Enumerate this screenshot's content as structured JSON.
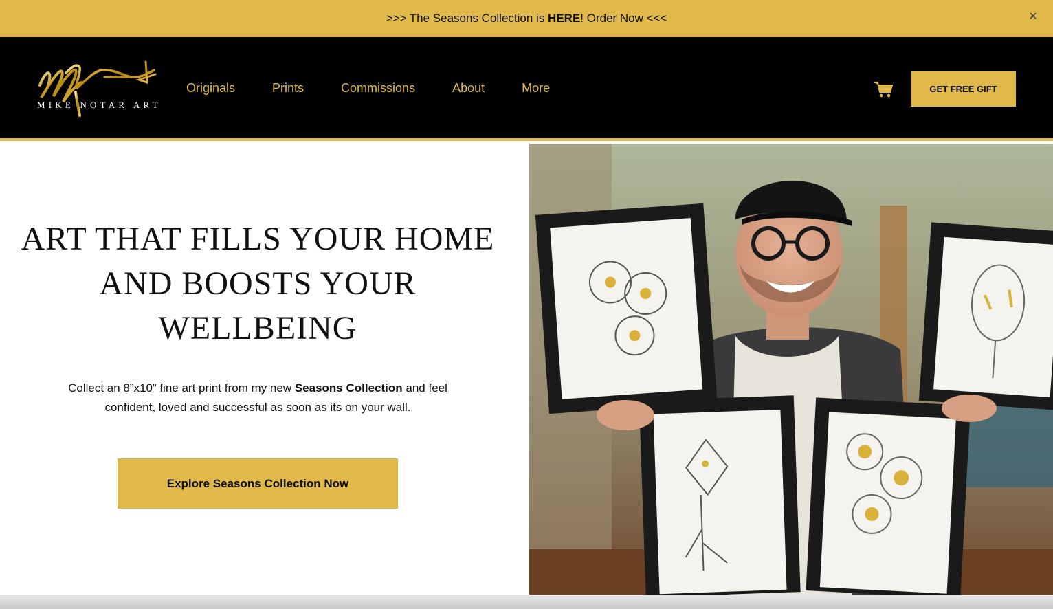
{
  "announcement": {
    "prefix": ">>> The Seasons Collection is ",
    "bold": "HERE",
    "suffix": "! Order Now <<<",
    "close_symbol": "×"
  },
  "brand": {
    "logo_text": "MIKE NOTAR ART"
  },
  "nav": {
    "items": [
      "Originals",
      "Prints",
      "Commissions",
      "About",
      "More"
    ]
  },
  "header": {
    "cart_icon": "shopping-cart-icon",
    "gift_button_label": "GET FREE GIFT"
  },
  "hero": {
    "headline": "ART THAT FILLS YOUR HOME AND BOOSTS YOUR WELLBEING",
    "sub_prefix": "Collect an 8”x10” fine art print from my new ",
    "sub_bold": "Seasons Collection",
    "sub_suffix": " and feel confident, loved and successful as soon as its on your wall.",
    "cta_label": "Explore Seasons Collection Now"
  },
  "colors": {
    "accent": "#e1b94a",
    "header_bg": "#000000"
  }
}
